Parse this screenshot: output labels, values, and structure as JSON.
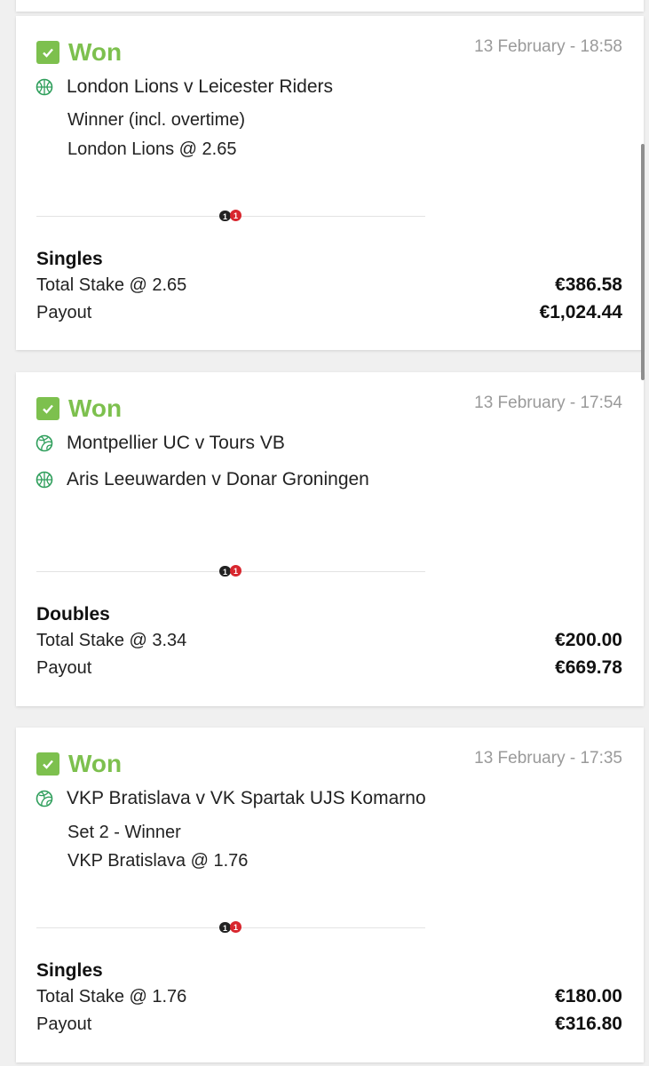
{
  "bets": [
    {
      "status": "Won",
      "date": "13 February - 18:58",
      "events": [
        {
          "sport": "basketball",
          "name": "London Lions v Leicester Riders"
        }
      ],
      "market": "Winner (incl. overtime)",
      "selection": "London Lions @ 2.65",
      "bet_type": "Singles",
      "stake_label": "Total Stake @ 2.65",
      "stake_value": "€386.58",
      "payout_label": "Payout",
      "payout_value": "€1,024.44"
    },
    {
      "status": "Won",
      "date": "13 February - 17:54",
      "events": [
        {
          "sport": "volleyball",
          "name": "Montpellier UC v Tours VB"
        },
        {
          "sport": "basketball",
          "name": "Aris Leeuwarden v Donar Groningen"
        }
      ],
      "bet_type": "Doubles",
      "stake_label": "Total Stake @ 3.34",
      "stake_value": "€200.00",
      "payout_label": "Payout",
      "payout_value": "€669.78"
    },
    {
      "status": "Won",
      "date": "13 February - 17:35",
      "events": [
        {
          "sport": "volleyball",
          "name": "VKP Bratislava v VK Spartak UJS Komarno"
        }
      ],
      "market": "Set 2 - Winner",
      "selection": "VKP Bratislava @ 1.76",
      "bet_type": "Singles",
      "stake_label": "Total Stake @ 1.76",
      "stake_value": "€180.00",
      "payout_label": "Payout",
      "payout_value": "€316.80"
    }
  ],
  "colors": {
    "won": "#7dc04e",
    "icon": "#2e9e5b",
    "brand_red": "#d8262e"
  }
}
